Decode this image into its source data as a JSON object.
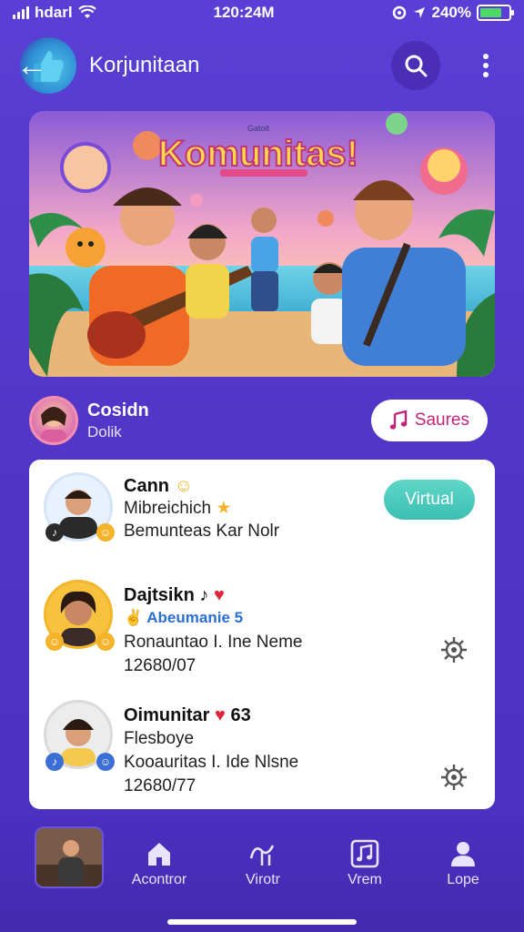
{
  "status_bar": {
    "carrier": "hdarl",
    "time": "120:24M",
    "battery": "240%"
  },
  "app_bar": {
    "title": "Korjunitaan"
  },
  "banner": {
    "small_text": "Gatoit",
    "title": "Komunitas!"
  },
  "host": {
    "name": "Cosidn",
    "subtitle": "Dolik",
    "button_label": "Saures"
  },
  "members": [
    {
      "name": "Cann",
      "line1": "Mibreichich",
      "line2": "Bemunteas Kar Nolr",
      "action_label": "Virtual"
    },
    {
      "name": "Dajtsikn",
      "line1": "Abeumanie 5",
      "line2": "Ronauntao I. Ine Neme",
      "line3": "12680/07"
    },
    {
      "name": "Oimunitar",
      "name_suffix": "63",
      "line1": "Flesboye",
      "line2": "Kooauritas I. Ide Nlsne",
      "line3": "12680/77"
    }
  ],
  "nav": {
    "tabs": [
      {
        "label": "Acontror",
        "icon": "home-icon"
      },
      {
        "label": "Virotr",
        "icon": "music-route-icon"
      },
      {
        "label": "Vrem",
        "icon": "music-note-icon"
      },
      {
        "label": "Lope",
        "icon": "profile-icon"
      }
    ]
  },
  "colors": {
    "accent": "#5a3fd6",
    "pill_text": "#c2247a",
    "virtual_button": "#3cbfb3"
  }
}
